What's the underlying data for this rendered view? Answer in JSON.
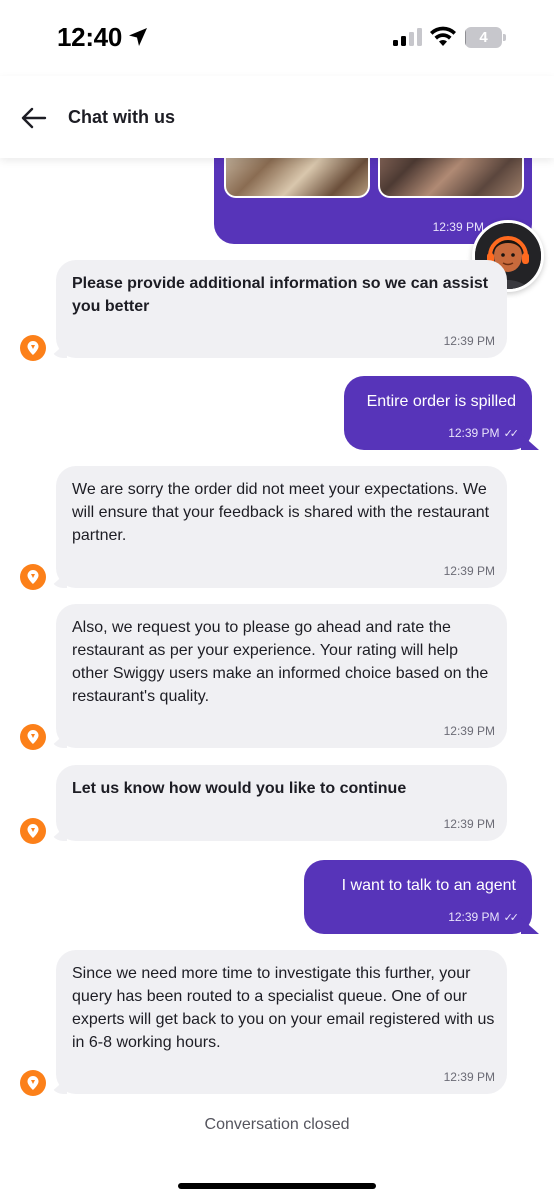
{
  "status_bar": {
    "time": "12:40",
    "battery": "4",
    "battery_level": 0.04
  },
  "header": {
    "title": "Chat with us"
  },
  "messages": [
    {
      "sender": "user",
      "type": "images",
      "time": "12:39 PM"
    },
    {
      "sender": "bot",
      "text": "Please provide additional information so we can assist you better",
      "time": "12:39 PM"
    },
    {
      "sender": "user",
      "text": "Entire order is spilled",
      "time": "12:39 PM"
    },
    {
      "sender": "bot",
      "text": "We are sorry the order did not meet your expectations. We will ensure that your feedback is shared with the restaurant partner.",
      "time": "12:39 PM"
    },
    {
      "sender": "bot",
      "text": "Also, we request you to please go ahead and rate the restaurant as per your experience. Your rating will help other Swiggy users make an informed choice based on the restaurant's quality.",
      "time": "12:39 PM"
    },
    {
      "sender": "bot",
      "text": "Let us know how would you like to continue",
      "time": "12:39 PM"
    },
    {
      "sender": "user",
      "text": "I want to talk to an agent",
      "time": "12:39 PM"
    },
    {
      "sender": "bot",
      "text": "Since we need more time to investigate this further, your query has been routed to a specialist queue. One of our experts will get back to you on your email registered with us in 6-8 working hours.",
      "time": "12:39 PM"
    }
  ],
  "footer": {
    "conversation_status": "Conversation closed"
  },
  "colors": {
    "user_bubble": "#5734b9",
    "bot_bubble": "#f0f0f3",
    "brand_orange": "#fc8019"
  }
}
